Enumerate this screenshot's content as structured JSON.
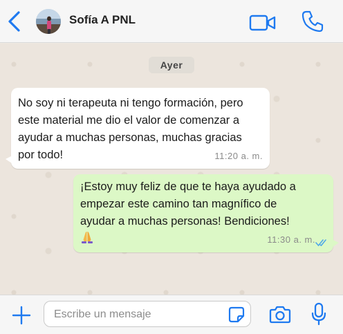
{
  "header": {
    "contact_name": "Sofía A PNL",
    "icons": {
      "back": "chevron-left-icon",
      "avatar": "profile-photo",
      "video": "video-camera-icon",
      "call": "phone-icon"
    }
  },
  "chat": {
    "date_label": "Ayer",
    "messages": [
      {
        "direction": "incoming",
        "text": "No soy ni terapeuta ni tengo formación, pero\neste material me dio el valor de comenzar a\nayudar a muchas personas, muchas gracias\npor todo!",
        "time": "11:20 a. m."
      },
      {
        "direction": "outgoing",
        "text": "¡Estoy muy feliz de que te haya ayudado a\nempezar este camino tan magnífico de\nayudar a muchas personas! Bendiciones!",
        "emoji": "folded-hands-emoji",
        "time": "11:30 a. m.",
        "status": "read"
      }
    ]
  },
  "footer": {
    "input_placeholder": "Escribe un mensaje",
    "input_value": "",
    "icons": {
      "plus": "plus-icon",
      "sticker": "sticker-icon",
      "camera": "camera-icon",
      "mic": "microphone-icon"
    }
  },
  "colors": {
    "accent": "#1f7af0",
    "outgoing_bubble": "#dcf8c6",
    "incoming_bubble": "#ffffff",
    "chat_background": "#ece5dd",
    "read_ticks": "#4fa8e8"
  }
}
